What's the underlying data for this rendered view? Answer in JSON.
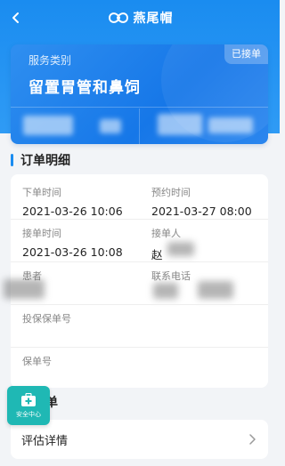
{
  "navbar": {
    "brand_name": "燕尾帽",
    "back_icon": "chevron-left-icon",
    "logo_icon": "swallow-logo-icon"
  },
  "service_card": {
    "label": "服务类别",
    "name": "留置胃管和鼻饲",
    "status": "已接单"
  },
  "order_section": {
    "title": "订单明细",
    "fields": {
      "order_time_label": "下单时间",
      "order_time_value": "2021-03-26 10:06",
      "appointment_label": "预约时间",
      "appointment_value": "2021-03-27 08:00",
      "accept_time_label": "接单时间",
      "accept_time_value": "2021-03-26 10:08",
      "acceptor_label": "接单人",
      "acceptor_value": "赵",
      "patient_label": "患者",
      "phone_label": "联系电话",
      "insurance_no_label": "投保保单号",
      "policy_no_label": "保单号"
    }
  },
  "evaluation_section": {
    "title": "评估单",
    "row_label": "评估详情"
  },
  "safety_center": {
    "label": "安全中心",
    "icon": "medical-kit-icon"
  },
  "colors": {
    "primary": "#1a8cf0",
    "safety": "#1fb8b4"
  }
}
